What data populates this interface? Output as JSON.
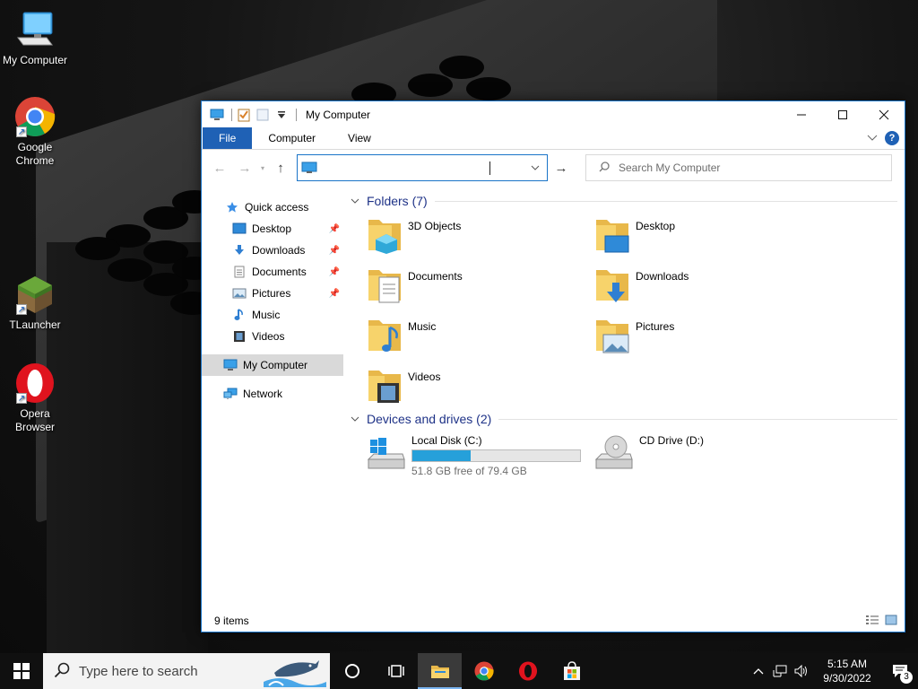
{
  "desktop": {
    "icons": [
      {
        "label": "My Computer",
        "icon": "monitor-icon"
      },
      {
        "label": "Google Chrome",
        "icon": "chrome-icon"
      },
      {
        "label": "TLauncher",
        "icon": "tlauncher-icon"
      },
      {
        "label": "Opera Browser",
        "icon": "opera-icon"
      }
    ]
  },
  "window": {
    "title": "My Computer",
    "ribbon_tabs": [
      "File",
      "Computer",
      "View"
    ],
    "address": {
      "value": ""
    },
    "search": {
      "placeholder": "Search My Computer"
    },
    "sidebar": {
      "quick_access": "Quick access",
      "items": [
        {
          "label": "Desktop",
          "pinned": true
        },
        {
          "label": "Downloads",
          "pinned": true
        },
        {
          "label": "Documents",
          "pinned": true
        },
        {
          "label": "Pictures",
          "pinned": true
        },
        {
          "label": "Music",
          "pinned": false
        },
        {
          "label": "Videos",
          "pinned": false
        }
      ],
      "this_pc": "My Computer",
      "network": "Network"
    },
    "folders_group": "Folders (7)",
    "folders": [
      "3D Objects",
      "Desktop",
      "Documents",
      "Downloads",
      "Music",
      "Pictures",
      "Videos"
    ],
    "drives_group": "Devices and drives (2)",
    "drives": [
      {
        "name": "Local Disk (C:)",
        "free": "51.8 GB free of 79.4 GB",
        "used_fraction": 0.348
      },
      {
        "name": "CD Drive (D:)"
      }
    ],
    "status": "9 items"
  },
  "taskbar": {
    "search_placeholder": "Type here to search",
    "time": "5:15 AM",
    "date": "9/30/2022",
    "notification_count": "3"
  },
  "colors": {
    "accent": "#1f61b5",
    "usage_bar": "#26a0da",
    "group_header": "#1e3287"
  }
}
